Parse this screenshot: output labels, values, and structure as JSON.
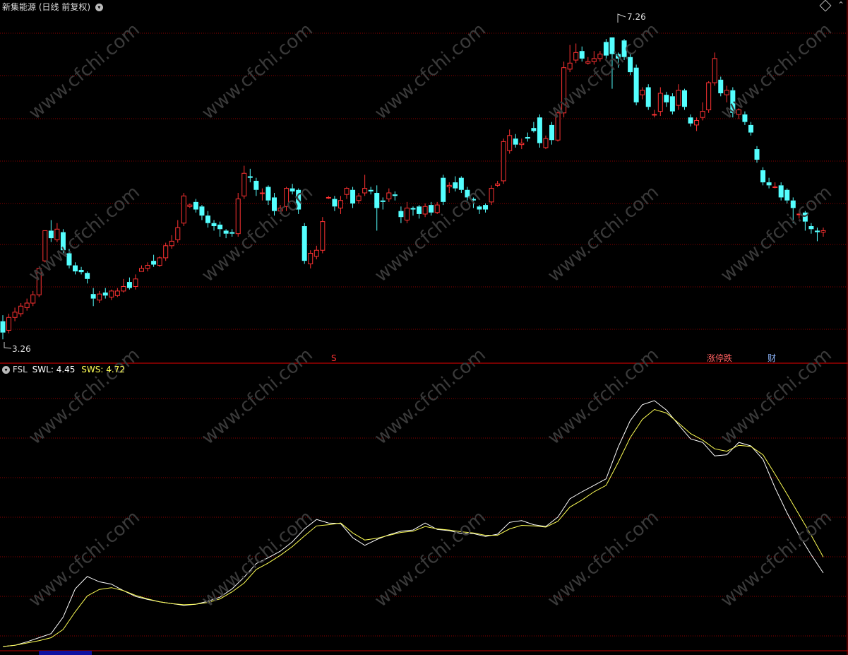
{
  "header": {
    "stock_name": "新集能源",
    "period_info": "(日线 前复权)",
    "indicator_name": "FSL",
    "swl_label": "SWL:",
    "swl_value": "4.45",
    "sws_label": "SWS:",
    "sws_value": "4.72"
  },
  "annotations": {
    "high_label": "7.26",
    "low_label": "3.26",
    "signal_s": "S",
    "signal_news": "涨停跌",
    "signal_cai": "财"
  },
  "watermark": "www.cfchi.com",
  "colors": {
    "up": "#ff3232",
    "down": "#54ffff",
    "swl": "#ffffff",
    "sws": "#ffff55",
    "grid": "#8b0000",
    "background": "#000000"
  },
  "chart_data": [
    {
      "type": "candlestick",
      "ylim": [
        3.15,
        7.55
      ],
      "high_marker": 7.26,
      "low_marker": 3.26,
      "candles": [
        [
          3.5,
          3.35,
          3.58,
          3.26
        ],
        [
          3.38,
          3.55,
          3.6,
          3.34
        ],
        [
          3.55,
          3.62,
          3.68,
          3.5
        ],
        [
          3.6,
          3.7,
          3.74,
          3.56
        ],
        [
          3.68,
          3.74,
          3.8,
          3.64
        ],
        [
          3.74,
          3.85,
          3.9,
          3.7
        ],
        [
          3.85,
          4.2,
          4.2,
          3.82
        ],
        [
          4.3,
          4.7,
          4.7,
          4.28
        ],
        [
          4.7,
          4.6,
          4.84,
          4.55
        ],
        [
          4.58,
          4.72,
          4.8,
          4.55
        ],
        [
          4.68,
          4.44,
          4.72,
          4.4
        ],
        [
          4.4,
          4.24,
          4.46,
          4.2
        ],
        [
          4.24,
          4.16,
          4.28,
          4.12
        ],
        [
          4.18,
          4.15,
          4.22,
          4.12
        ],
        [
          4.14,
          4.06,
          4.16,
          4.0
        ],
        [
          3.86,
          3.8,
          3.94,
          3.7
        ],
        [
          3.78,
          3.86,
          3.9,
          3.74
        ],
        [
          3.88,
          3.84,
          3.94,
          3.8
        ],
        [
          3.82,
          3.9,
          3.92,
          3.78
        ],
        [
          3.84,
          3.9,
          3.94,
          3.82
        ],
        [
          3.9,
          3.96,
          4.06,
          3.88
        ],
        [
          4.02,
          3.94,
          4.08,
          3.92
        ],
        [
          3.96,
          4.06,
          4.12,
          3.92
        ],
        [
          4.16,
          4.2,
          4.24,
          4.16
        ],
        [
          4.2,
          4.24,
          4.28,
          4.16
        ],
        [
          4.3,
          4.25,
          4.38,
          4.22
        ],
        [
          4.24,
          4.34,
          4.36,
          4.22
        ],
        [
          4.34,
          4.5,
          4.54,
          4.3
        ],
        [
          4.5,
          4.56,
          4.64,
          4.46
        ],
        [
          4.58,
          4.74,
          4.84,
          4.54
        ],
        [
          4.8,
          5.16,
          5.2,
          4.76
        ],
        [
          5.02,
          5.04,
          5.06,
          5.0
        ],
        [
          5.08,
          4.98,
          5.12,
          4.94
        ],
        [
          5.02,
          4.9,
          5.04,
          4.84
        ],
        [
          4.9,
          4.8,
          4.96,
          4.74
        ],
        [
          4.8,
          4.76,
          4.84,
          4.7
        ],
        [
          4.78,
          4.72,
          4.82,
          4.62
        ],
        [
          4.7,
          4.66,
          4.72,
          4.6
        ],
        [
          4.68,
          4.66,
          4.72,
          4.62
        ],
        [
          4.66,
          5.12,
          5.2,
          4.62
        ],
        [
          5.16,
          5.46,
          5.56,
          5.12
        ],
        [
          5.42,
          5.4,
          5.52,
          5.34
        ],
        [
          5.36,
          5.24,
          5.4,
          5.16
        ],
        [
          5.2,
          5.2,
          5.26,
          5.1
        ],
        [
          5.28,
          5.1,
          5.3,
          5.04
        ],
        [
          5.14,
          4.96,
          5.2,
          4.9
        ],
        [
          4.96,
          5.0,
          5.04,
          4.92
        ],
        [
          5.02,
          5.26,
          5.28,
          4.96
        ],
        [
          5.26,
          5.22,
          5.32,
          5.18
        ],
        [
          5.24,
          4.98,
          5.26,
          4.92
        ],
        [
          4.76,
          4.3,
          4.8,
          4.26
        ],
        [
          4.26,
          4.4,
          4.44,
          4.2
        ],
        [
          4.36,
          4.44,
          4.5,
          4.32
        ],
        [
          4.44,
          4.82,
          4.88,
          4.4
        ],
        [
          5.14,
          5.14,
          5.16,
          5.12
        ],
        [
          5.12,
          5.02,
          5.16,
          4.96
        ],
        [
          5.0,
          5.1,
          5.16,
          4.92
        ],
        [
          5.18,
          5.26,
          5.28,
          5.12
        ],
        [
          5.24,
          5.06,
          5.28,
          5.0
        ],
        [
          5.1,
          5.16,
          5.2,
          5.06
        ],
        [
          5.2,
          5.26,
          5.44,
          5.16
        ],
        [
          5.24,
          5.22,
          5.28,
          5.18
        ],
        [
          5.2,
          5.0,
          5.3,
          4.7
        ],
        [
          5.1,
          5.08,
          5.14,
          4.98
        ],
        [
          5.12,
          5.2,
          5.26,
          5.08
        ],
        [
          5.18,
          5.16,
          5.22,
          5.1
        ],
        [
          4.96,
          4.88,
          5.02,
          4.8
        ],
        [
          4.84,
          5.0,
          5.08,
          4.8
        ],
        [
          5.0,
          4.98,
          5.02,
          4.9
        ],
        [
          5.02,
          4.92,
          5.04,
          4.86
        ],
        [
          4.92,
          5.02,
          5.06,
          4.88
        ],
        [
          5.04,
          4.94,
          5.08,
          4.9
        ],
        [
          4.94,
          5.04,
          5.08,
          4.92
        ],
        [
          5.4,
          5.08,
          5.44,
          5.04
        ],
        [
          5.28,
          5.3,
          5.34,
          5.2
        ],
        [
          5.34,
          5.26,
          5.42,
          5.22
        ],
        [
          5.4,
          5.24,
          5.42,
          5.2
        ],
        [
          5.24,
          5.14,
          5.28,
          5.1
        ],
        [
          5.12,
          5.1,
          5.14,
          5.0
        ],
        [
          5.02,
          4.98,
          5.04,
          4.92
        ],
        [
          5.04,
          4.98,
          5.06,
          4.94
        ],
        [
          5.08,
          5.26,
          5.3,
          5.04
        ],
        [
          5.3,
          5.32,
          5.36,
          5.28
        ],
        [
          5.36,
          5.88,
          5.92,
          5.32
        ],
        [
          5.76,
          5.96,
          6.04,
          5.72
        ],
        [
          5.92,
          5.84,
          5.98,
          5.8
        ],
        [
          5.84,
          5.86,
          5.92,
          5.78
        ],
        [
          5.94,
          5.92,
          6.0,
          5.88
        ],
        [
          6.06,
          6.02,
          6.14,
          6.0
        ],
        [
          6.2,
          5.86,
          6.24,
          5.8
        ],
        [
          5.8,
          5.92,
          5.96,
          5.78
        ],
        [
          6.1,
          5.9,
          6.14,
          5.84
        ],
        [
          5.9,
          6.26,
          6.28,
          5.88
        ],
        [
          6.26,
          6.86,
          6.94,
          6.2
        ],
        [
          6.84,
          6.92,
          7.16,
          6.8
        ],
        [
          6.96,
          7.06,
          7.18,
          6.92
        ],
        [
          7.08,
          6.98,
          7.14,
          6.94
        ],
        [
          6.92,
          6.94,
          7.0,
          6.9
        ],
        [
          6.94,
          6.98,
          7.08,
          6.9
        ],
        [
          6.98,
          7.04,
          7.08,
          6.94
        ],
        [
          7.2,
          7.02,
          7.24,
          6.98
        ],
        [
          7.26,
          7.04,
          7.26,
          6.58
        ],
        [
          7.04,
          6.98,
          7.06,
          6.86
        ],
        [
          7.22,
          7.0,
          7.24,
          6.96
        ],
        [
          7.0,
          6.8,
          7.06,
          6.76
        ],
        [
          6.86,
          6.4,
          6.9,
          6.36
        ],
        [
          6.5,
          6.56,
          6.6,
          6.44
        ],
        [
          6.6,
          6.34,
          6.64,
          6.3
        ],
        [
          6.24,
          6.24,
          6.3,
          6.2
        ],
        [
          6.28,
          6.52,
          6.6,
          6.22
        ],
        [
          6.5,
          6.4,
          6.54,
          6.34
        ],
        [
          6.48,
          6.28,
          6.52,
          6.24
        ],
        [
          6.36,
          6.56,
          6.64,
          6.3
        ],
        [
          6.56,
          6.34,
          6.58,
          6.3
        ],
        [
          6.2,
          6.12,
          6.24,
          6.08
        ],
        [
          6.1,
          6.16,
          6.2,
          6.02
        ],
        [
          6.2,
          6.28,
          6.4,
          6.16
        ],
        [
          6.3,
          6.66,
          6.68,
          6.26
        ],
        [
          6.66,
          6.98,
          7.06,
          6.62
        ],
        [
          6.7,
          6.52,
          6.74,
          6.48
        ],
        [
          6.5,
          6.56,
          6.62,
          6.4
        ],
        [
          6.56,
          6.26,
          6.6,
          6.2
        ],
        [
          6.24,
          6.3,
          6.32,
          6.18
        ],
        [
          6.24,
          6.14,
          6.28,
          6.1
        ],
        [
          6.1,
          6.0,
          6.14,
          5.96
        ],
        [
          5.78,
          5.64,
          5.82,
          5.6
        ],
        [
          5.5,
          5.34,
          5.54,
          5.3
        ],
        [
          5.34,
          5.3,
          5.4,
          5.26
        ],
        [
          5.28,
          5.28,
          5.34,
          5.26
        ],
        [
          5.3,
          5.14,
          5.34,
          5.1
        ],
        [
          5.24,
          5.1,
          5.26,
          5.06
        ],
        [
          5.1,
          5.0,
          5.14,
          4.8
        ],
        [
          4.92,
          4.92,
          4.96,
          4.86
        ],
        [
          4.94,
          4.82,
          4.96,
          4.7
        ],
        [
          4.76,
          4.72,
          4.8,
          4.66
        ],
        [
          4.7,
          4.68,
          4.74,
          4.56
        ],
        [
          4.68,
          4.7,
          4.74,
          4.62
        ]
      ]
    },
    {
      "type": "line",
      "ylim": [
        3.2,
        7.8
      ],
      "series": [
        {
          "name": "SWL",
          "values": [
            3.2,
            3.22,
            3.28,
            3.35,
            3.42,
            3.7,
            4.18,
            4.39,
            4.3,
            4.26,
            4.15,
            4.05,
            4.0,
            3.96,
            3.93,
            3.9,
            3.92,
            3.97,
            4.04,
            4.18,
            4.38,
            4.61,
            4.71,
            4.82,
            4.98,
            5.2,
            5.36,
            5.3,
            5.29,
            5.05,
            4.92,
            5.02,
            5.1,
            5.16,
            5.18,
            5.3,
            5.19,
            5.17,
            5.12,
            5.12,
            5.07,
            5.11,
            5.31,
            5.34,
            5.27,
            5.24,
            5.4,
            5.71,
            5.83,
            5.94,
            6.05,
            6.59,
            7.04,
            7.31,
            7.38,
            7.22,
            6.97,
            6.73,
            6.67,
            6.44,
            6.46,
            6.67,
            6.61,
            6.38,
            5.9,
            5.47,
            5.09,
            4.76,
            4.45
          ]
        },
        {
          "name": "SWS",
          "values": [
            3.2,
            3.22,
            3.26,
            3.3,
            3.35,
            3.49,
            3.79,
            4.06,
            4.17,
            4.2,
            4.15,
            4.07,
            4.01,
            3.96,
            3.93,
            3.91,
            3.92,
            3.95,
            4.01,
            4.13,
            4.28,
            4.51,
            4.62,
            4.75,
            4.9,
            5.08,
            5.25,
            5.27,
            5.3,
            5.13,
            5.01,
            5.04,
            5.09,
            5.14,
            5.16,
            5.24,
            5.2,
            5.18,
            5.15,
            5.13,
            5.09,
            5.09,
            5.2,
            5.26,
            5.25,
            5.23,
            5.33,
            5.57,
            5.69,
            5.83,
            5.94,
            6.33,
            6.75,
            7.06,
            7.23,
            7.17,
            7.0,
            6.82,
            6.71,
            6.56,
            6.52,
            6.62,
            6.6,
            6.46,
            6.13,
            5.79,
            5.44,
            5.09,
            4.72
          ]
        }
      ]
    }
  ]
}
